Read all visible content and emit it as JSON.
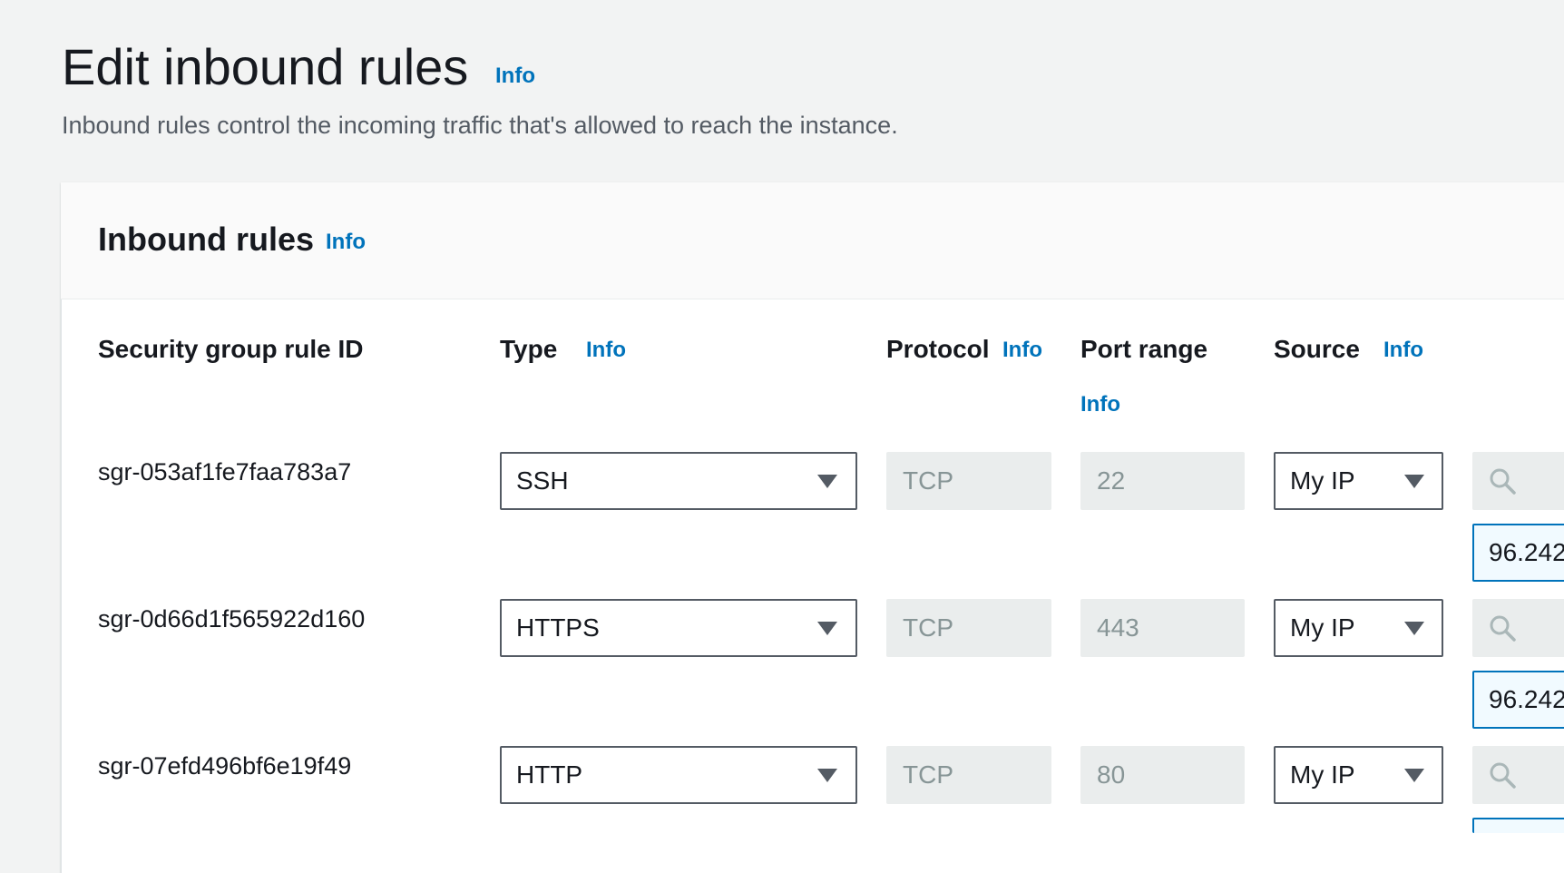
{
  "header": {
    "title": "Edit inbound rules",
    "info": "Info",
    "description": "Inbound rules control the incoming traffic that's allowed to reach the instance."
  },
  "panel": {
    "title": "Inbound rules",
    "info": "Info"
  },
  "columns": {
    "rule_id": "Security group rule ID",
    "type": "Type",
    "type_info": "Info",
    "protocol": "Protocol",
    "protocol_info": "Info",
    "port_range": "Port range",
    "port_range_info": "Info",
    "source": "Source",
    "source_info": "Info"
  },
  "rules": [
    {
      "id": "sgr-053af1fe7faa783a7",
      "type": "SSH",
      "protocol": "TCP",
      "port_range": "22",
      "source": "My IP",
      "source_cidr": "96.242"
    },
    {
      "id": "sgr-0d66d1f565922d160",
      "type": "HTTPS",
      "protocol": "TCP",
      "port_range": "443",
      "source": "My IP",
      "source_cidr": "96.242"
    },
    {
      "id": "sgr-07efd496bf6e19f49",
      "type": "HTTP",
      "protocol": "TCP",
      "port_range": "80",
      "source": "My IP",
      "source_cidr": ""
    }
  ],
  "icons": {
    "dropdown": "caret-down-icon",
    "search": "search-icon"
  },
  "colors": {
    "link": "#0073bb",
    "background": "#f2f3f3",
    "text": "#16191f"
  }
}
